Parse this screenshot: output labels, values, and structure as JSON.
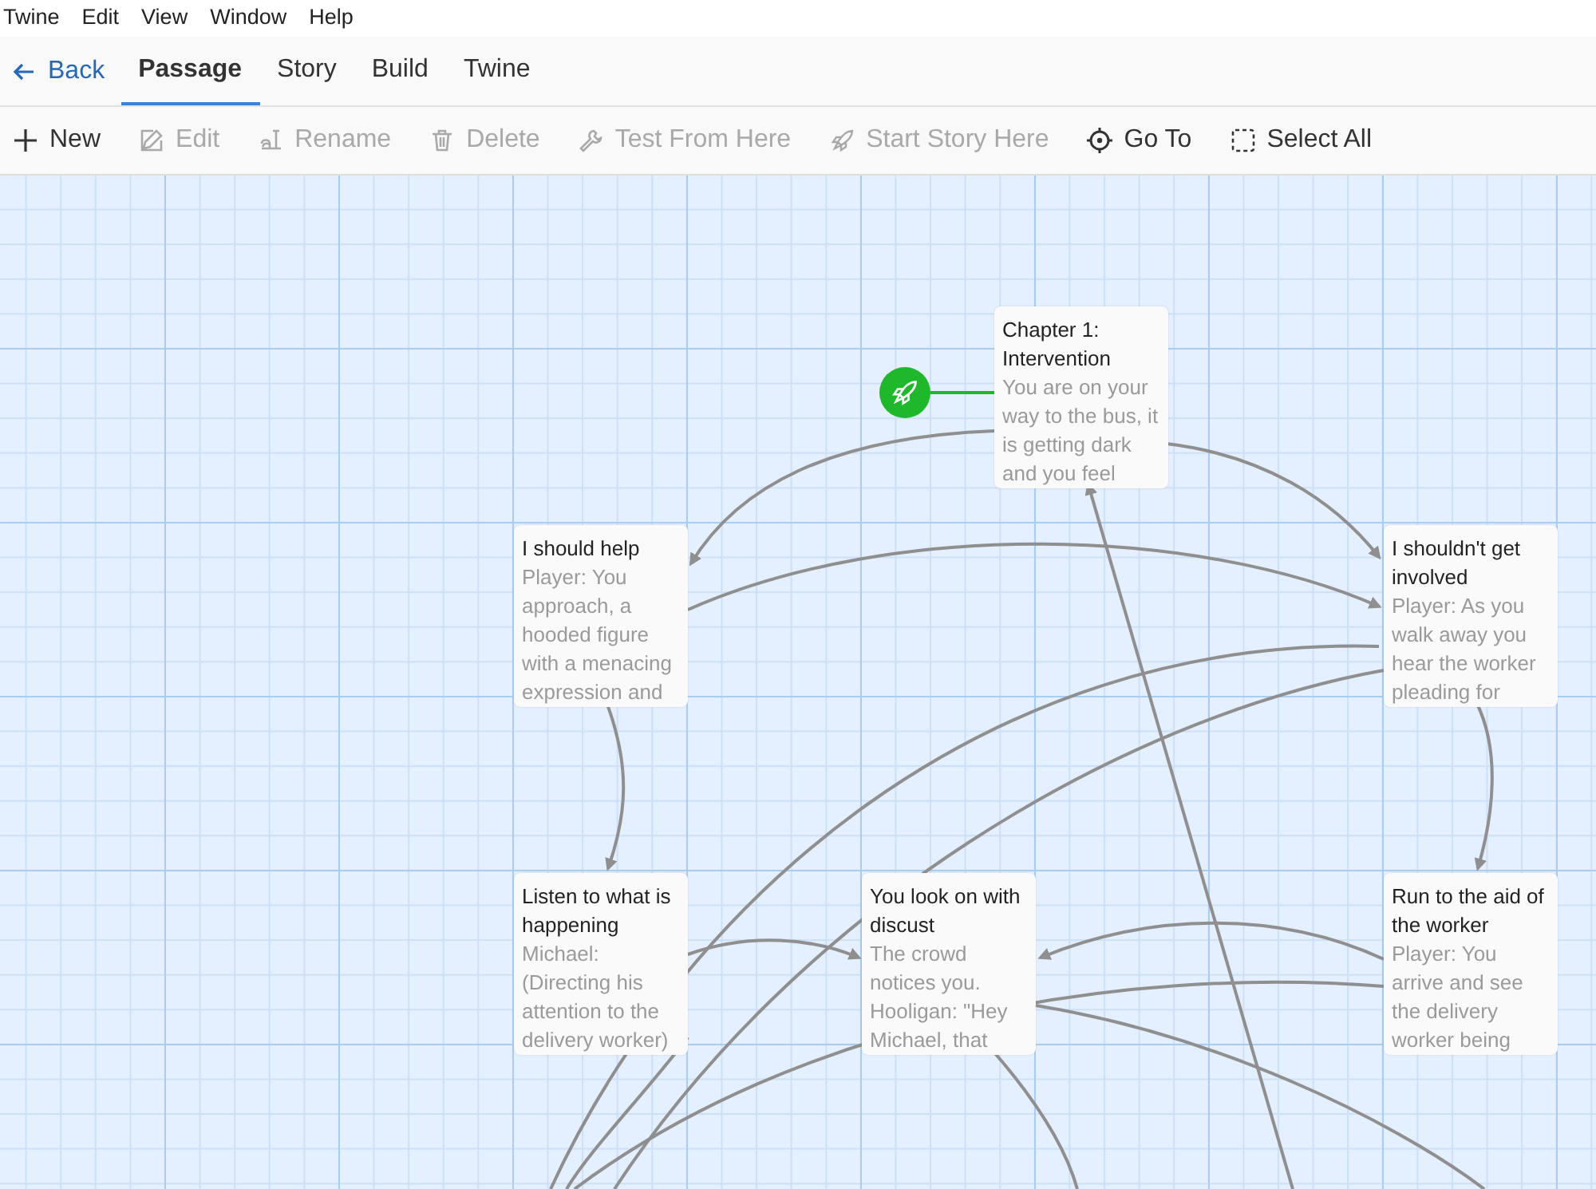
{
  "menu_bar": [
    "Twine",
    "Edit",
    "View",
    "Window",
    "Help"
  ],
  "back_button": {
    "label": "Back"
  },
  "tabs": [
    {
      "label": "Passage",
      "selected": true
    },
    {
      "label": "Story",
      "selected": false
    },
    {
      "label": "Build",
      "selected": false
    },
    {
      "label": "Twine",
      "selected": false
    }
  ],
  "toolbar": [
    {
      "kind": "new",
      "label": "New",
      "disabled": false
    },
    {
      "kind": "edit",
      "label": "Edit",
      "disabled": true
    },
    {
      "kind": "rename",
      "label": "Rename",
      "disabled": true
    },
    {
      "kind": "delete",
      "label": "Delete",
      "disabled": true
    },
    {
      "kind": "test",
      "label": "Test From Here",
      "disabled": true
    },
    {
      "kind": "start",
      "label": "Start Story Here",
      "disabled": true
    },
    {
      "kind": "goto",
      "label": "Go To",
      "disabled": false
    },
    {
      "kind": "select",
      "label": "Select All",
      "disabled": false
    }
  ],
  "passages": [
    {
      "title": "Chapter 1: Intervention",
      "excerpt": "You are on your way to the bus, it is getting dark and you feel",
      "start": true
    },
    {
      "title": "I should help",
      "excerpt": "Player: You approach, a hooded figure with a menacing expression and",
      "start": false
    },
    {
      "title": "I shouldn't get involved",
      "excerpt": "Player: As you walk away you hear the worker pleading for",
      "start": false
    },
    {
      "title": "Listen to what is happening",
      "excerpt": "Michael: (Directing his attention to the delivery worker)",
      "start": false
    },
    {
      "title": "You look on with discust",
      "excerpt": "The crowd notices you. Hooligan: \"Hey Michael, that",
      "start": false
    },
    {
      "title": "Run to the aid of the worker",
      "excerpt": "Player: You arrive and see the delivery worker being",
      "start": false
    }
  ]
}
